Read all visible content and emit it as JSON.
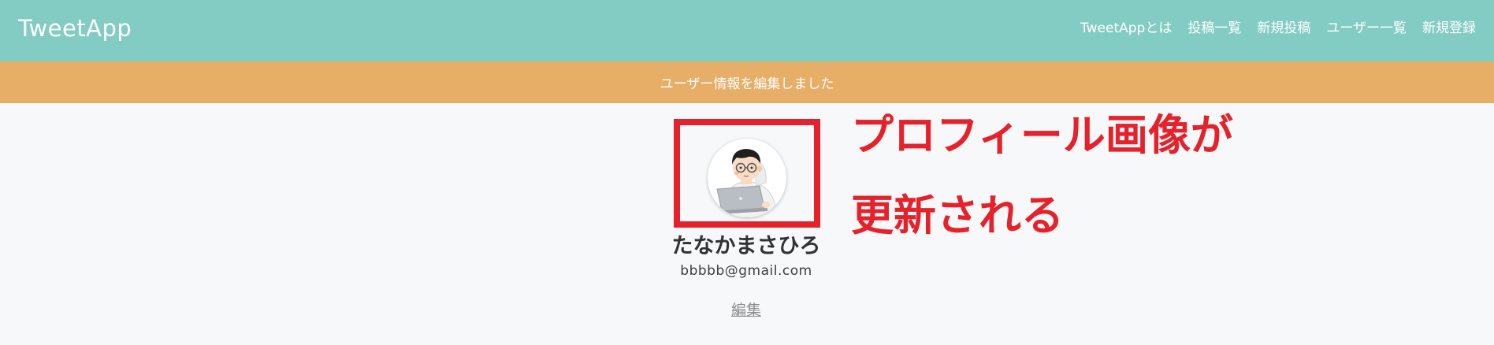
{
  "header": {
    "brand": "TweetApp",
    "nav": [
      {
        "label": "TweetAppとは"
      },
      {
        "label": "投稿一覧"
      },
      {
        "label": "新規投稿"
      },
      {
        "label": "ユーザー一覧"
      },
      {
        "label": "新規登録"
      }
    ]
  },
  "flash": {
    "message": "ユーザー情報を編集しました"
  },
  "profile": {
    "name": "たなかまさひろ",
    "email": "bbbbb@gmail.com",
    "edit_label": "編集"
  },
  "annotation": {
    "line1": "プロフィール画像が",
    "line2": "更新される"
  },
  "colors": {
    "header_bg": "#83ccc4",
    "flash_bg": "#e6ae66",
    "annotation_red": "#e5222c",
    "page_bg": "#f7f8fa"
  }
}
